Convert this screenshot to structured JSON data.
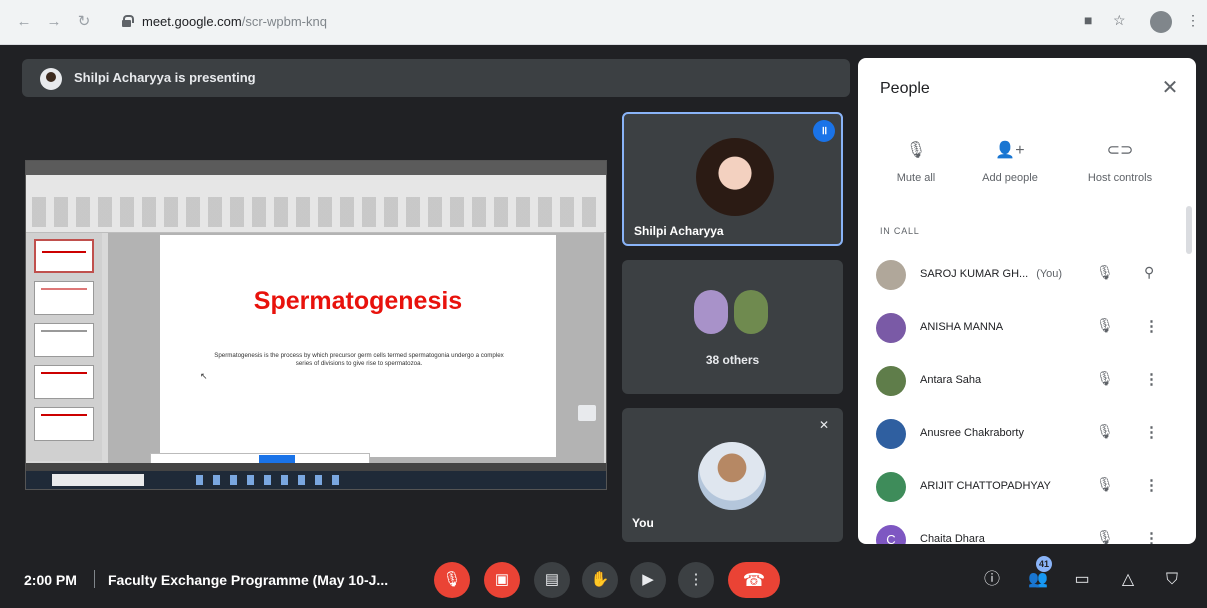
{
  "browser": {
    "url_host": "meet.google.com",
    "url_path": "/scr-wpbm-knq"
  },
  "presenter_bar": {
    "text": "Shilpi Acharyya is presenting"
  },
  "slide": {
    "title": "Spermatogenesis",
    "body": "Spermatogenesis is the process by which precursor germ cells termed spermatogonia undergo a complex series of divisions to give rise to spermatozoa."
  },
  "tiles": {
    "active_speaker": "Shilpi Acharyya",
    "others": "38 others",
    "self": "You"
  },
  "people_panel": {
    "title": "People",
    "actions": [
      "Mute all",
      "Add people",
      "Host controls"
    ],
    "section_label": "IN CALL",
    "participants": [
      {
        "name": "SAROJ KUMAR GH...",
        "tag": "(You)",
        "avatar_color": "#b0a79a"
      },
      {
        "name": "ANISHA MANNA",
        "tag": "",
        "avatar_color": "#7a5aa6"
      },
      {
        "name": "Antara Saha",
        "tag": "",
        "avatar_color": "#5f7d4a"
      },
      {
        "name": "Anusree Chakraborty",
        "tag": "",
        "avatar_color": "#2f5fa0"
      },
      {
        "name": "ARIJIT CHATTOPADHYAY",
        "tag": "",
        "avatar_color": "#3e8c5a"
      },
      {
        "name": "Chaita Dhara",
        "tag": "",
        "avatar_color": "#7e57c2",
        "initial": "C"
      }
    ]
  },
  "bottom_bar": {
    "time": "2:00 PM",
    "meeting_title": "Faculty Exchange Programme (May 10-J...",
    "participant_count": "41"
  },
  "colors": {
    "accent": "#1a73e8",
    "danger": "#ea4335",
    "background": "#202124"
  }
}
